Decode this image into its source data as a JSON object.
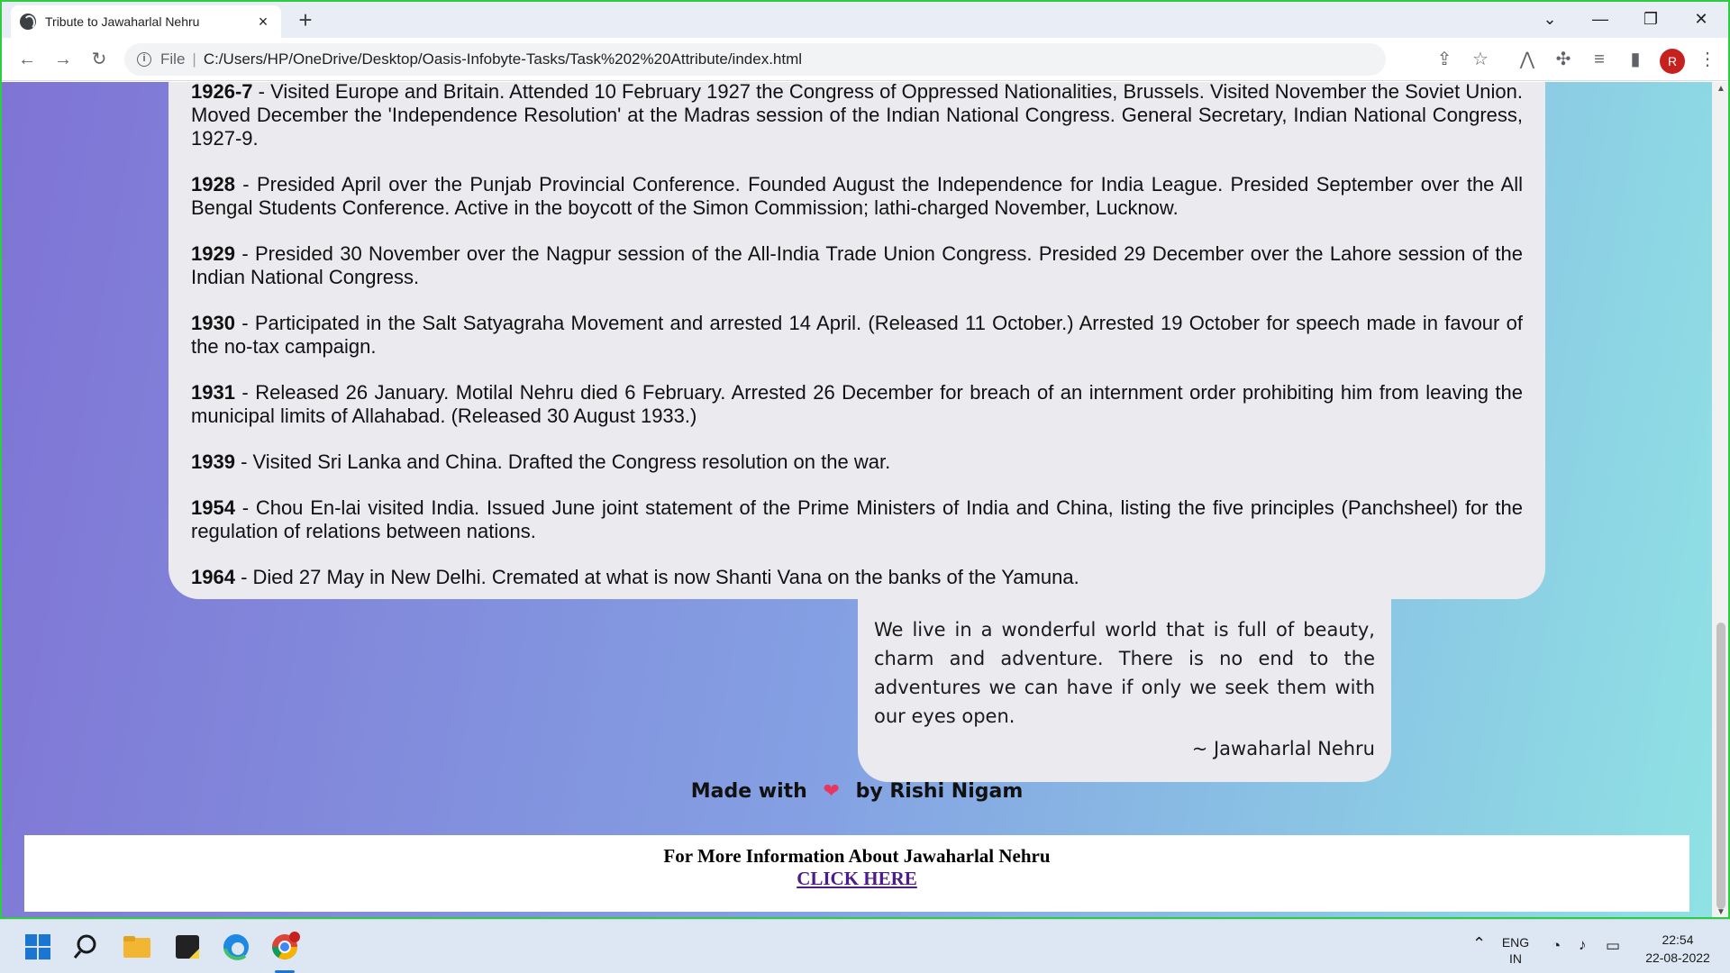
{
  "browser": {
    "tab_title": "Tribute to Jawaharlal Nehru",
    "tab_close": "×",
    "new_tab": "+",
    "scheme_label": "File",
    "url": "C:/Users/HP/OneDrive/Desktop/Oasis-Infobyte-Tasks/Task%202%20Attribute/index.html",
    "profile_initial": "R"
  },
  "timeline": [
    {
      "year": "1926-7",
      "text": " - Visited Europe and Britain. Attended 10 February 1927 the Congress of Oppressed Nationalities, Brussels. Visited November the Soviet Union. Moved December the 'Independence Resolution' at the Madras session of the Indian National Congress. General Secretary, Indian National Congress, 1927-9."
    },
    {
      "year": "1928",
      "text": " - Presided April over the Punjab Provincial Conference. Founded August the Independence for India League. Presided September over the All Bengal Students Conference. Active in the boycott of the Simon Commission; lathi-charged November, Lucknow."
    },
    {
      "year": "1929",
      "text": " - Presided 30 November over the Nagpur session of the All-India Trade Union Congress. Presided 29 December over the Lahore session of the Indian National Congress."
    },
    {
      "year": "1930",
      "text": " - Participated in the Salt Satyagraha Movement and arrested 14 April. (Released 11 October.) Arrested 19 October for speech made in favour of the no-tax campaign."
    },
    {
      "year": "1931",
      "text": " - Released 26 January. Motilal Nehru died 6 February. Arrested 26 December for breach of an internment order prohibiting him from leaving the municipal limits of Allahabad. (Released 30 August 1933.)"
    },
    {
      "year": "1939",
      "text": " - Visited Sri Lanka and China. Drafted the Congress resolution on the war."
    },
    {
      "year": "1954",
      "text": " - Chou En-lai visited India. Issued June joint statement of the Prime Ministers of India and China, listing the five principles (Panchsheel) for the regulation of relations between nations."
    },
    {
      "year": "1964",
      "text": " - Died 27 May in New Delhi. Cremated at what is now Shanti Vana on the banks of the Yamuna."
    }
  ],
  "quote": {
    "text": "We live in a wonderful world that is full of beauty, charm and adventure. There is no end to the adventures we can have if only we seek them with our eyes open.",
    "author": "~ Jawaharlal Nehru"
  },
  "footer": {
    "made_with": "Made with",
    "by": "by Rishi Nigam",
    "info_text": "For More Information About Jawaharlal Nehru",
    "link_text": "CLICK HERE"
  },
  "taskbar": {
    "lang_primary": "ENG",
    "lang_secondary": "IN",
    "time": "22:54",
    "date": "22-08-2022"
  },
  "colors": {
    "page_gradient_start": "#7f74d4",
    "page_gradient_end": "#8fe2e4",
    "card_bg": "#ebebef",
    "link_color": "#4b1c8a"
  }
}
